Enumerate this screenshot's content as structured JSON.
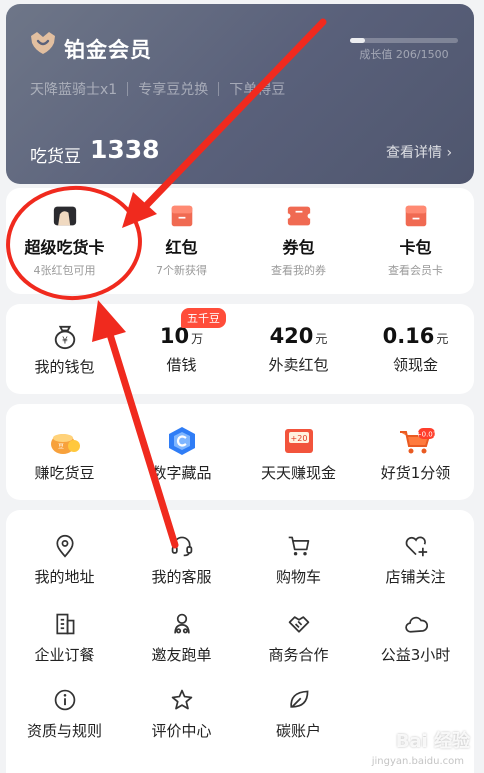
{
  "member": {
    "title": "铂金会员",
    "growth": "成长值 206/1500",
    "growth_fraction": 0.137,
    "perks": [
      "天降蓝骑士x1",
      "专享豆兑换",
      "下单得豆"
    ],
    "beans_label": "吃货豆",
    "beans_value": "1338",
    "detail_link": "查看详情 ›"
  },
  "cards": [
    {
      "label": "超级吃货卡",
      "sub": "4张红包可用",
      "icon": "card-icon"
    },
    {
      "label": "红包",
      "sub": "7个新获得",
      "icon": "red-packet-icon"
    },
    {
      "label": "券包",
      "sub": "查看我的券",
      "icon": "coupon-icon"
    },
    {
      "label": "卡包",
      "sub": "查看会员卡",
      "icon": "card-wallet-icon"
    }
  ],
  "finance": [
    {
      "value": "",
      "unit": "",
      "label": "我的钱包",
      "icon": "wallet-icon"
    },
    {
      "value": "10",
      "unit": "万",
      "label": "借钱",
      "badge": "五千豆"
    },
    {
      "value": "420",
      "unit": "元",
      "label": "外卖红包"
    },
    {
      "value": "0.16",
      "unit": "元",
      "label": "领现金"
    }
  ],
  "promos": [
    {
      "label": "赚吃货豆",
      "icon": "bean-pot-icon"
    },
    {
      "label": "数字藏品",
      "icon": "digital-collection-icon"
    },
    {
      "label": "天天赚现金",
      "icon": "cash-envelope-icon",
      "icon_text": "+20"
    },
    {
      "label": "好货1分领",
      "icon": "shopping-cart-gift-icon",
      "icon_text": "+0.01"
    }
  ],
  "services": [
    [
      {
        "label": "我的地址",
        "icon": "location-icon"
      },
      {
        "label": "我的客服",
        "icon": "headset-icon"
      },
      {
        "label": "购物车",
        "icon": "cart-icon"
      },
      {
        "label": "店铺关注",
        "icon": "heart-plus-icon"
      }
    ],
    [
      {
        "label": "企业订餐",
        "icon": "building-icon"
      },
      {
        "label": "邀友跑单",
        "icon": "rider-icon"
      },
      {
        "label": "商务合作",
        "icon": "handshake-icon"
      },
      {
        "label": "公益3小时",
        "icon": "cloud-icon"
      }
    ],
    [
      {
        "label": "资质与规则",
        "icon": "info-icon"
      },
      {
        "label": "评价中心",
        "icon": "star-icon"
      },
      {
        "label": "碳账户",
        "icon": "leaf-icon"
      }
    ]
  ],
  "colors": {
    "accent": "#ff4d3a",
    "annotation": "#f02a1e",
    "member_bg": "#5b627a"
  },
  "watermark": {
    "title": "Bai 经验",
    "subtitle": "jingyan.baidu.com"
  }
}
